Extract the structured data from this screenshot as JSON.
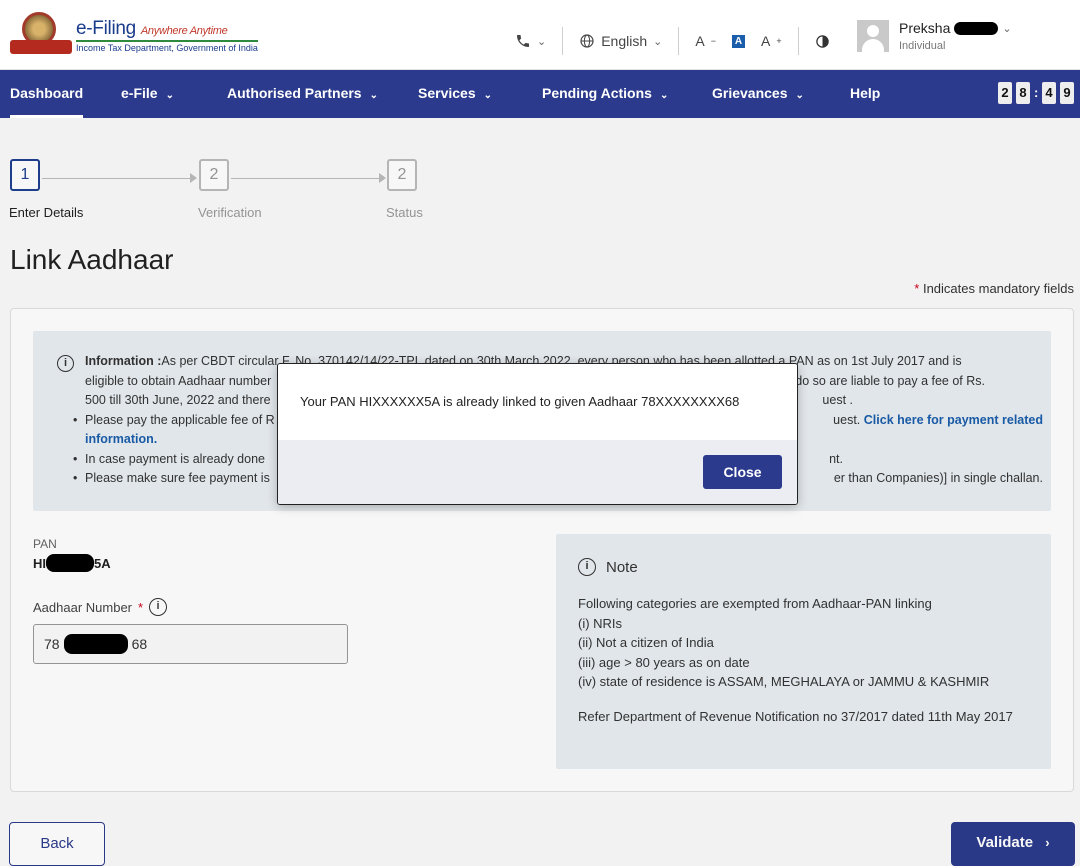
{
  "header": {
    "logo_title": "e-Filing",
    "logo_tagline": "Anywhere Anytime",
    "logo_subtitle": "Income Tax Department, Government of India",
    "language": "English",
    "font_decrease": "A",
    "font_default": "A",
    "font_increase": "A",
    "user_name": "Preksha",
    "user_role": "Individual"
  },
  "nav": {
    "items": [
      {
        "label": "Dashboard"
      },
      {
        "label": "e-File"
      },
      {
        "label": "Authorised Partners"
      },
      {
        "label": "Services"
      },
      {
        "label": "Pending Actions"
      },
      {
        "label": "Grievances"
      },
      {
        "label": "Help"
      }
    ],
    "timer": [
      "2",
      "8",
      ":",
      "4",
      "9"
    ]
  },
  "stepper": [
    {
      "number": "1",
      "label": "Enter Details"
    },
    {
      "number": "2",
      "label": "Verification"
    },
    {
      "number": "2",
      "label": "Status"
    }
  ],
  "page": {
    "title": "Link Aadhaar",
    "mandatory_note": "Indicates mandatory fields"
  },
  "info": {
    "lead_bold": "Information :",
    "lead_text": "As per CBDT circular F. No. 370142/14/22-TPL dated on 30th March 2022, every person who has been allotted a PAN as on 1st July 2017 and is",
    "line2_left": "eligible to obtain Aadhaar number",
    "line2_right": "ed to do so are liable to pay a fee of Rs.",
    "line3_left": "500 till 30th June, 2022 and there",
    "line3_right": "uest .",
    "bullet1_left": "Please pay the applicable fee of R",
    "bullet1_right": "uest.",
    "bullet1_link": "Click here for payment related",
    "bullet1_link2": "information.",
    "bullet2_left": "In case payment is already done",
    "bullet2_right": "nt.",
    "bullet3_left": "Please make sure fee payment is",
    "bullet3_right": "er than Companies)] in single challan."
  },
  "form": {
    "pan_label": "PAN",
    "pan_prefix": "HI",
    "pan_suffix": "5A",
    "aadhaar_label": "Aadhaar Number",
    "aadhaar_prefix": "78",
    "aadhaar_suffix": "68"
  },
  "note": {
    "title": "Note",
    "intro": "Following categories are exempted from Aadhaar-PAN linking",
    "items": [
      "(i) NRIs",
      "(ii) Not a citizen of India",
      "(iii) age > 80 years as on date",
      "(iv) state of residence is ASSAM, MEGHALAYA or JAMMU & KASHMIR"
    ],
    "reference": "Refer Department of Revenue Notification no 37/2017 dated 11th May 2017"
  },
  "buttons": {
    "back": "Back",
    "validate": "Validate"
  },
  "modal": {
    "message": "Your PAN HIXXXXXX5A is already linked to given Aadhaar 78XXXXXXXX68",
    "close": "Close"
  }
}
